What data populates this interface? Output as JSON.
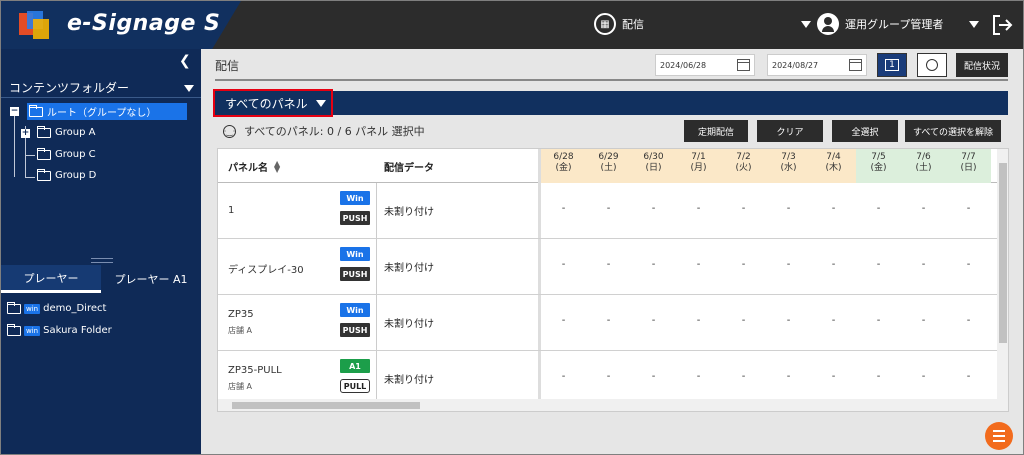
{
  "app": {
    "title": "e-Signage S"
  },
  "header": {
    "center_label": "配信",
    "user_label": "運用グループ管理者"
  },
  "sidebar": {
    "folder_title": "コンテンツフォルダー",
    "tree": {
      "root": "ルート（グループなし）",
      "groups": [
        "Group A",
        "Group C",
        "Group D"
      ]
    },
    "player_tabs": [
      "プレーヤー",
      "プレーヤー A1"
    ],
    "players": [
      {
        "badge": "win",
        "name": "demo_Direct"
      },
      {
        "badge": "win",
        "name": "Sakura Folder"
      }
    ]
  },
  "main": {
    "title": "配信",
    "date_from": "2024/06/28",
    "date_to": "2024/08/27",
    "calendar_day": "1",
    "status_button": "配信状況",
    "panel_select": "すべてのパネル",
    "selection_info": "すべてのパネル: 0 / 6 パネル 選択中",
    "actions": [
      "定期配信",
      "クリア",
      "全選択",
      "すべての選択を解除"
    ]
  },
  "grid": {
    "col_name": "パネル名",
    "col_data": "配信データ",
    "days": [
      {
        "date": "6/28",
        "dow": "(金)"
      },
      {
        "date": "6/29",
        "dow": "(土)"
      },
      {
        "date": "6/30",
        "dow": "(日)"
      },
      {
        "date": "7/1",
        "dow": "(月)"
      },
      {
        "date": "7/2",
        "dow": "(火)"
      },
      {
        "date": "7/3",
        "dow": "(水)"
      },
      {
        "date": "7/4",
        "dow": "(木)"
      },
      {
        "date": "7/5",
        "dow": "(金)"
      },
      {
        "date": "7/6",
        "dow": "(土)"
      },
      {
        "date": "7/7",
        "dow": "(日)"
      }
    ],
    "empty_cell": "-",
    "rows": [
      {
        "name": "1",
        "sub": "",
        "type_badge": "Win",
        "mode_badge": "PUSH",
        "data": "未割り付け"
      },
      {
        "name": "ディスプレイ-30",
        "sub": "",
        "type_badge": "Win",
        "mode_badge": "PUSH",
        "data": "未割り付け"
      },
      {
        "name": "ZP35",
        "sub": "店舗 A",
        "type_badge": "Win",
        "mode_badge": "PUSH",
        "data": "未割り付け"
      },
      {
        "name": "ZP35-PULL",
        "sub": "店舗 A",
        "type_badge": "A1",
        "mode_badge": "PULL",
        "data": "未割り付け"
      }
    ]
  },
  "colors": {
    "brand_navy": "#11305f",
    "accent_blue": "#1a73e8",
    "highlight_red": "#e60012",
    "fab_orange": "#f26b1d"
  }
}
